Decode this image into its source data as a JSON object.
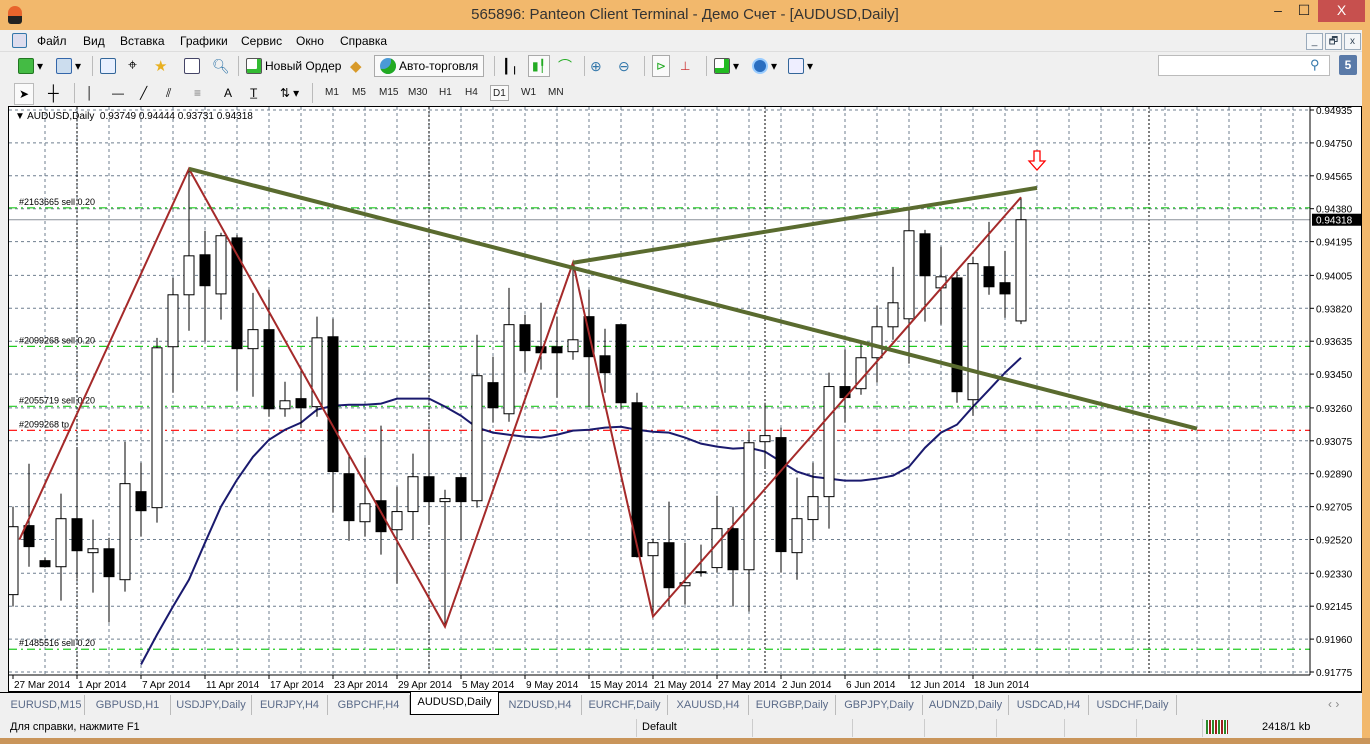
{
  "window": {
    "title": "565896: Panteon Client Terminal - Демо Счет - [AUDUSD,Daily]",
    "controls": [
      "–",
      "☐",
      "X"
    ]
  },
  "menu": [
    "Файл",
    "Вид",
    "Вставка",
    "Графики",
    "Сервис",
    "Окно",
    "Справка"
  ],
  "mdi_controls": [
    "_",
    "🗗",
    "x"
  ],
  "toolbar": {
    "new_order": "Новый Ордер",
    "auto_trading": "Авто-торговля",
    "search_placeholder": "",
    "badge": "5"
  },
  "timeframes": [
    "M1",
    "M5",
    "M15",
    "M30",
    "H1",
    "H4",
    "D1",
    "W1",
    "MN"
  ],
  "active_timeframe": "D1",
  "drawing_tools": [
    "cursor",
    "crosshair",
    "vertical-line",
    "horizontal-line",
    "trend-line",
    "fibo-channel",
    "fibo-retracement",
    "text",
    "text-label",
    "arrows"
  ],
  "chart_header": "AUDUSD,Daily  0.93749 0.94444 0.93731 0.94318",
  "chart_data": {
    "type": "candlestick",
    "symbol": "AUDUSD",
    "timeframe": "Daily",
    "ylim": [
      0.91775,
      0.94935
    ],
    "y_ticks": [
      "0.94935",
      "0.94750",
      "0.94565",
      "0.94380",
      "0.94195",
      "0.94005",
      "0.93820",
      "0.93635",
      "0.93450",
      "0.93260",
      "0.93075",
      "0.92890",
      "0.92705",
      "0.92520",
      "0.92330",
      "0.92145",
      "0.91960",
      "0.91775"
    ],
    "x_labels": [
      "27 Mar 2014",
      "1 Apr 2014",
      "7 Apr 2014",
      "11 Apr 2014",
      "17 Apr 2014",
      "23 Apr 2014",
      "29 Apr 2014",
      "5 May 2014",
      "9 May 2014",
      "15 May 2014",
      "21 May 2014",
      "27 May 2014",
      "2 Jun 2014",
      "6 Jun 2014",
      "12 Jun 2014",
      "18 Jun 2014"
    ],
    "x_label_every_bars": 4,
    "grid": true,
    "current_price": "0.94318",
    "ohlc_columns": [
      "open",
      "high",
      "low",
      "close"
    ],
    "candles": [
      [
        0.9221,
        0.92705,
        0.92143,
        0.92592
      ],
      [
        0.92598,
        0.92946,
        0.92367,
        0.9248
      ],
      [
        0.92401,
        0.92418,
        0.92362,
        0.92367
      ],
      [
        0.92367,
        0.92778,
        0.92176,
        0.92637
      ],
      [
        0.92637,
        0.93031,
        0.923,
        0.92457
      ],
      [
        0.92446,
        0.92632,
        0.92221,
        0.92468
      ],
      [
        0.92468,
        0.9253,
        0.92053,
        0.92311
      ],
      [
        0.92294,
        0.9307,
        0.92227,
        0.92834
      ],
      [
        0.92789,
        0.92952,
        0.92536,
        0.92682
      ],
      [
        0.92699,
        0.93654,
        0.92615,
        0.93598
      ],
      [
        0.93604,
        0.93992,
        0.93345,
        0.93896
      ],
      [
        0.93896,
        0.94604,
        0.93694,
        0.94115
      ],
      [
        0.94121,
        0.94256,
        0.93632,
        0.93947
      ],
      [
        0.93901,
        0.94245,
        0.93756,
        0.94228
      ],
      [
        0.94216,
        0.94233,
        0.93357,
        0.93593
      ],
      [
        0.93593,
        0.93907,
        0.93323,
        0.937
      ],
      [
        0.937,
        0.93924,
        0.9321,
        0.93255
      ],
      [
        0.93255,
        0.93407,
        0.9321,
        0.933
      ],
      [
        0.93312,
        0.93475,
        0.93148,
        0.93261
      ],
      [
        0.93267,
        0.93773,
        0.9321,
        0.93654
      ],
      [
        0.9366,
        0.93762,
        0.92671,
        0.92902
      ],
      [
        0.9289,
        0.93003,
        0.92513,
        0.92626
      ],
      [
        0.9262,
        0.9298,
        0.92536,
        0.92721
      ],
      [
        0.92738,
        0.9316,
        0.92435,
        0.92564
      ],
      [
        0.92575,
        0.92817,
        0.92272,
        0.92677
      ],
      [
        0.92677,
        0.93003,
        0.92519,
        0.92873
      ],
      [
        0.92873,
        0.93121,
        0.92603,
        0.92733
      ],
      [
        0.92733,
        0.928,
        0.9203,
        0.9275
      ],
      [
        0.92868,
        0.9289,
        0.92519,
        0.92733
      ],
      [
        0.92738,
        0.93671,
        0.92699,
        0.93441
      ],
      [
        0.93402,
        0.93548,
        0.93177,
        0.93261
      ],
      [
        0.93227,
        0.93935,
        0.93182,
        0.93728
      ],
      [
        0.93728,
        0.93784,
        0.93458,
        0.93582
      ],
      [
        0.93604,
        0.93851,
        0.93475,
        0.9357
      ],
      [
        0.93604,
        0.93773,
        0.93318,
        0.9357
      ],
      [
        0.93576,
        0.94076,
        0.93531,
        0.93643
      ],
      [
        0.93773,
        0.93924,
        0.93267,
        0.93548
      ],
      [
        0.93553,
        0.93705,
        0.93345,
        0.93458
      ],
      [
        0.93728,
        0.93728,
        0.93255,
        0.93289
      ],
      [
        0.93289,
        0.93345,
        0.92418,
        0.92424
      ],
      [
        0.92429,
        0.92525,
        0.92087,
        0.92502
      ],
      [
        0.92502,
        0.92733,
        0.92143,
        0.92249
      ],
      [
        0.9226,
        0.92502,
        0.92154,
        0.92277
      ],
      [
        0.92339,
        0.92491,
        0.92311,
        0.92339
      ],
      [
        0.92362,
        0.92766,
        0.92334,
        0.92581
      ],
      [
        0.92581,
        0.92705,
        0.92143,
        0.9235
      ],
      [
        0.9235,
        0.93126,
        0.92115,
        0.93064
      ],
      [
        0.9307,
        0.93289,
        0.92918,
        0.93104
      ],
      [
        0.93093,
        0.93149,
        0.92334,
        0.92452
      ],
      [
        0.92446,
        0.92868,
        0.92294,
        0.92637
      ],
      [
        0.92632,
        0.92952,
        0.92519,
        0.92761
      ],
      [
        0.92761,
        0.93458,
        0.92581,
        0.9338
      ],
      [
        0.9338,
        0.93588,
        0.93177,
        0.93318
      ],
      [
        0.93368,
        0.93632,
        0.93334,
        0.93542
      ],
      [
        0.93542,
        0.93834,
        0.93402,
        0.93716
      ],
      [
        0.93716,
        0.94053,
        0.93643,
        0.93851
      ],
      [
        0.93761,
        0.94379,
        0.93509,
        0.94256
      ],
      [
        0.94239,
        0.94261,
        0.93745,
        0.94003
      ],
      [
        0.93935,
        0.94166,
        0.93728,
        0.93997
      ],
      [
        0.93991,
        0.94025,
        0.93289,
        0.93351
      ],
      [
        0.93306,
        0.9411,
        0.93216,
        0.94071
      ],
      [
        0.94054,
        0.94306,
        0.93896,
        0.93941
      ],
      [
        0.93964,
        0.94143,
        0.93767,
        0.93901
      ],
      [
        0.93749,
        0.94444,
        0.93731,
        0.94318
      ]
    ],
    "moving_average": {
      "color": "#1a1a6e",
      "start_bar": 8,
      "values": [
        0.91817,
        0.91985,
        0.92143,
        0.92294,
        0.92502,
        0.92705,
        0.92856,
        0.92985,
        0.93081,
        0.93137,
        0.93177,
        0.9325,
        0.93272,
        0.93278,
        0.93278,
        0.93284,
        0.93312,
        0.93312,
        0.93312,
        0.93267,
        0.93216,
        0.93149,
        0.93121,
        0.93109,
        0.93098,
        0.93093,
        0.93109,
        0.93132,
        0.93137,
        0.93149,
        0.93154,
        0.93137,
        0.93126,
        0.93121,
        0.93093,
        0.93059,
        0.93042,
        0.93031,
        0.93036,
        0.93014,
        0.92958,
        0.92902,
        0.92873,
        0.92862,
        0.92851,
        0.92851,
        0.92862,
        0.92879,
        0.92929,
        0.93036,
        0.93121,
        0.93166,
        0.93267,
        0.93362,
        0.93458,
        0.93542
      ]
    },
    "zigzag": {
      "color": "#a52a2a",
      "points": [
        [
          0.4,
          0.92519
        ],
        [
          11,
          0.94604
        ],
        [
          27,
          0.9203
        ],
        [
          35,
          0.94076
        ],
        [
          40,
          0.92087
        ],
        [
          63,
          0.94444
        ]
      ]
    },
    "trendlines": [
      {
        "color": "#5a6b2f",
        "from": [
          11,
          0.94604
        ],
        "to": [
          74,
          0.93143
        ]
      },
      {
        "color": "#5a6b2f",
        "from": [
          35,
          0.94076
        ],
        "to": [
          64,
          0.94497
        ]
      }
    ],
    "period_separators_at_bars": [
      4,
      26,
      47,
      71
    ],
    "sell_arrow": {
      "bar": 64,
      "color": "#ff0000"
    },
    "trade_levels": [
      {
        "label": "#2163665 sell 0.20",
        "price": 0.94385,
        "color": "#22cc22"
      },
      {
        "label": "#2099268 sell 0.20",
        "price": 0.93606,
        "color": "#22cc22"
      },
      {
        "label": "#2055719 sell 0.20",
        "price": 0.93269,
        "color": "#22cc22"
      },
      {
        "label": "#2099268 tp",
        "price": 0.93134,
        "color": "#ff0000"
      },
      {
        "label": "#1485516 sell 0.20",
        "price": 0.91903,
        "color": "#22cc22"
      }
    ]
  },
  "tabs": [
    "EURUSD,M15",
    "GBPUSD,H1",
    "USDJPY,Daily",
    "EURJPY,H4",
    "GBPCHF,H4",
    "AUDUSD,Daily",
    "NZDUSD,H4",
    "EURCHF,Daily",
    "XAUUSD,H4",
    "EURGBP,Daily",
    "GBPJPY,Daily",
    "AUDNZD,Daily",
    "USDCAD,H4",
    "USDCHF,Daily"
  ],
  "active_tab": "AUDUSD,Daily",
  "status": {
    "help": "Для справки, нажмите F1",
    "profile": "Default",
    "traffic": "2418/1 kb"
  }
}
